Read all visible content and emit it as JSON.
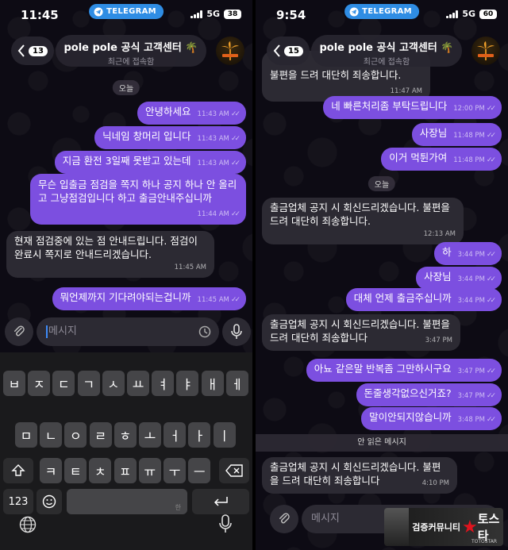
{
  "left": {
    "status": {
      "time": "11:45",
      "telegram": "TELEGRAM",
      "network": "5G",
      "battery": "38"
    },
    "header": {
      "back_count": "13",
      "title": "pole pole 공식 고객센터 🌴",
      "subtitle": "최근에 접속함"
    },
    "date": "오늘",
    "messages": [
      {
        "dir": "out",
        "text": "안녕하세요",
        "time": "11:43 AM"
      },
      {
        "dir": "out",
        "text": "닉네임 창머리 입니다",
        "time": "11:43 AM"
      },
      {
        "dir": "out",
        "text": "지금 환전 3일째 못받고 있는데",
        "time": "11:43 AM"
      },
      {
        "dir": "out",
        "text": "무슨 입출금 점검을 쪽지 하나 공지 하나 안 올리고  그냥점검입니다 하고 출금안내주십니까",
        "time": "11:44 AM"
      },
      {
        "dir": "in",
        "text": "현재 점검중에 있는 점 안내드립니다. 점검이 완료시 쪽지로 안내드리겠습니다.",
        "time": "11:45 AM"
      },
      {
        "dir": "out",
        "text": "뭐언제까지 기다려야되는겁니까",
        "time": "11:45 AM"
      }
    ],
    "input_placeholder": "메시지",
    "keyboard": {
      "row1": [
        "ㅂ",
        "ㅈ",
        "ㄷ",
        "ㄱ",
        "ㅅ",
        "ㅛ",
        "ㅕ",
        "ㅑ",
        "ㅐ",
        "ㅔ"
      ],
      "row2": [
        "ㅁ",
        "ㄴ",
        "ㅇ",
        "ㄹ",
        "ㅎ",
        "ㅗ",
        "ㅓ",
        "ㅏ",
        "ㅣ"
      ],
      "row3": [
        "ㅋ",
        "ㅌ",
        "ㅊ",
        "ㅍ",
        "ㅠ",
        "ㅜ",
        "ㅡ"
      ],
      "numbers_label": "123",
      "space_hint": "한"
    }
  },
  "right": {
    "status": {
      "time": "9:54",
      "telegram": "TELEGRAM",
      "network": "5G",
      "battery": "60"
    },
    "header": {
      "back_count": "15",
      "title": "pole pole 공식 고객센터 🌴",
      "subtitle": "최근에 접속함"
    },
    "messages_before": [
      {
        "dir": "in",
        "text": "불편을 드려 대단히 죄송합니다.",
        "time": "11:47 AM"
      },
      {
        "dir": "out",
        "text": "네 빠른처리좀 부탁드립니다",
        "time": "12:00 PM"
      },
      {
        "dir": "out",
        "text": "사장님",
        "time": "11:48 PM"
      },
      {
        "dir": "out",
        "text": "이거 먹튄가여",
        "time": "11:48 PM"
      }
    ],
    "date": "오늘",
    "messages_after": [
      {
        "dir": "in",
        "text": "출금업체 공지 시 회신드리겠습니다. 불편을 드려 대단히 죄송합니다.",
        "time": "12:13 AM"
      },
      {
        "dir": "out",
        "text": "하",
        "time": "3:44 PM"
      },
      {
        "dir": "out",
        "text": "사장님",
        "time": "3:44 PM"
      },
      {
        "dir": "out",
        "text": "대체 언제 출금주십니까",
        "time": "3:44 PM"
      },
      {
        "dir": "in",
        "text": "출금업체 공지 시 회신드리겠습니다. 불편을 드려 대단히 죄송합니다",
        "time": "3:47 PM"
      },
      {
        "dir": "out",
        "text": "아뇨 같은말 반복좀 그만하시구요",
        "time": "3:47 PM"
      },
      {
        "dir": "out",
        "text": "돈줄생각없으신거죠?",
        "time": "3:47 PM"
      },
      {
        "dir": "out",
        "text": "말이안되지않습니까",
        "time": "3:48 PM"
      }
    ],
    "unread_label": "안 읽은 메시지",
    "last_message": {
      "dir": "in",
      "text": "출금업체 공지 시 회신드리겠습니다. 불편을 드려 대단히 죄송합니다",
      "time": "4:10 PM"
    },
    "input_placeholder": "메시지",
    "watermark": {
      "line": "검증커뮤니티",
      "brand": "토스타",
      "sub": "TOTOSTAR"
    }
  }
}
